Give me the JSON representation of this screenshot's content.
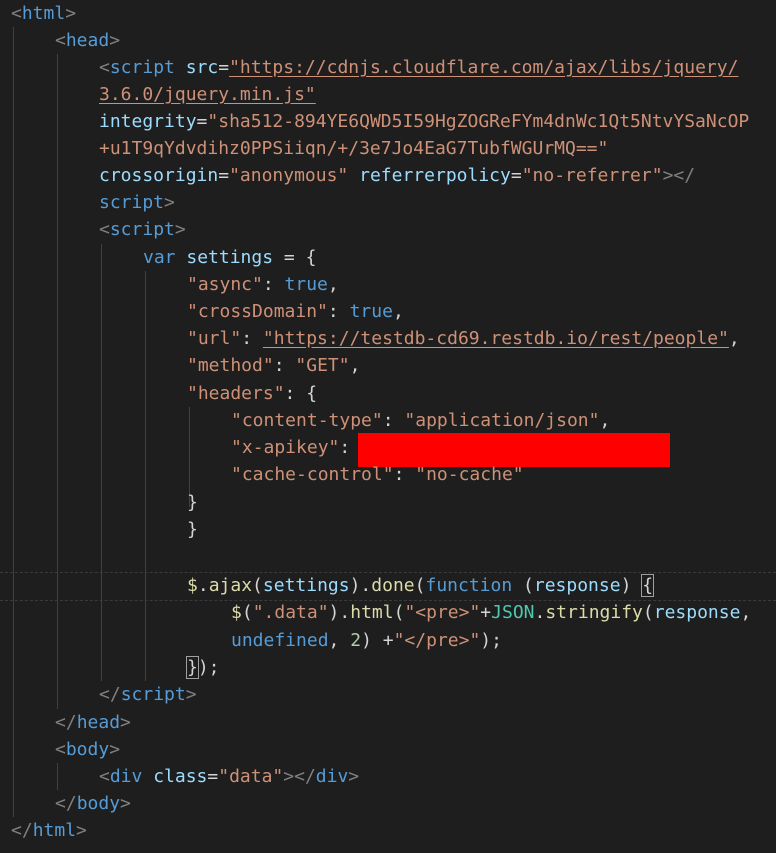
{
  "editor": {
    "lines": {
      "l1_tag": "html",
      "l2_tag": "head",
      "l3_tag": "script",
      "l3_attr": "src",
      "l3_val1": "\"https://cdnjs.cloudflare.com/ajax/libs/jquery/",
      "l4_val2": "3.6.0/jquery.min.js\"",
      "l5_attr": "integrity",
      "l5_val1": "\"sha512-894YE6QWD5I59HgZOGReFYm4dnWc1Qt5NtvYSaNcOP",
      "l6_val2": "+u1T9qYdvdihz0PPSiiqn/+/3e7Jo4EaG7TubfWGUrMQ==\"",
      "l7_attr1": "crossorigin",
      "l7_val1": "\"anonymous\"",
      "l7_attr2": "referrerpolicy",
      "l7_val2": "\"no-referrer\"",
      "l8_tag": "script",
      "l9_tag": "script",
      "l10_kw": "var",
      "l10_var": "settings",
      "l11_key": "\"async\"",
      "l11_val": "true",
      "l12_key": "\"crossDomain\"",
      "l12_val": "true",
      "l13_key": "\"url\"",
      "l13_val": "\"https://testdb-cd69.restdb.io/rest/people\"",
      "l14_key": "\"method\"",
      "l14_val": "\"GET\"",
      "l15_key": "\"headers\"",
      "l16_key": "\"content-type\"",
      "l16_val": "\"application/json\"",
      "l17_key": "\"x-apikey\"",
      "l18_key": "\"cache-control\"",
      "l18_val": "\"no-cache\"",
      "l22_dollar": "$",
      "l22_ajax": "ajax",
      "l22_settings": "settings",
      "l22_done": "done",
      "l22_function": "function",
      "l22_response": "response",
      "l23_dollar": "$",
      "l23_sel": "\".data\"",
      "l23_html": "html",
      "l23_pre": "\"<pre>\"",
      "l23_json": "JSON",
      "l23_stringify": "stringify",
      "l23_response": "response",
      "l24_undefined": "undefined",
      "l24_num": "2",
      "l24_pre_end": "\"</pre>\"",
      "l26_tag": "script",
      "l27_tag": "head",
      "l28_tag": "body",
      "l29_tag": "div",
      "l29_attr": "class",
      "l29_val": "\"data\"",
      "l29_tag2": "div",
      "l30_tag": "body",
      "l31_tag": "html"
    }
  },
  "colors": {
    "background": "#1e1e1e",
    "tag": "#569cd6",
    "attribute": "#9cdcfe",
    "string": "#ce9178",
    "function": "#dcdcaa",
    "class": "#4ec9b0",
    "number": "#b5cea8",
    "redaction": "#ff0000"
  }
}
